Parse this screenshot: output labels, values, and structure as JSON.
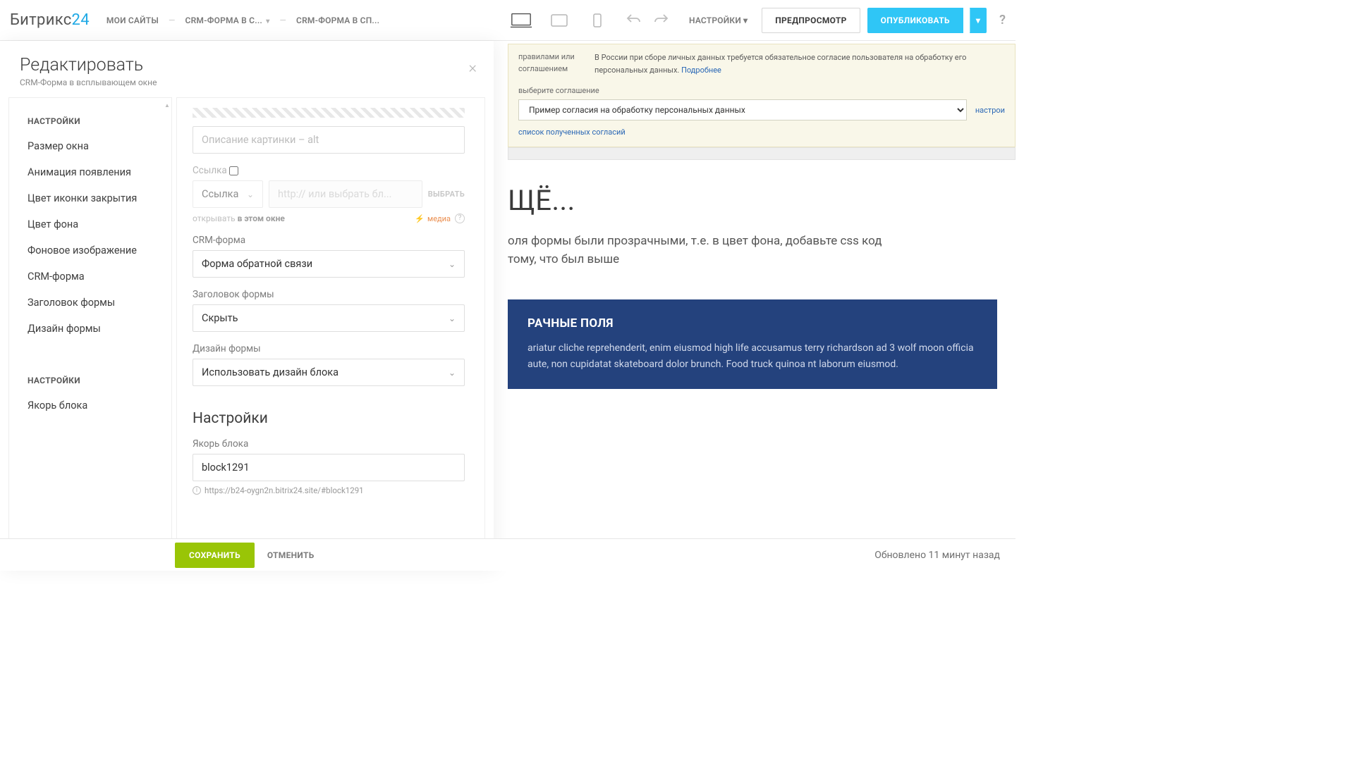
{
  "logo": {
    "part1": "Битрикс",
    "part2": "24"
  },
  "breadcrumbs": {
    "mysites": "МОИ САЙТЫ",
    "crm1": "CRM-ФОРМА В С...",
    "crm2": "CRM-ФОРМА В СП..."
  },
  "topbar": {
    "settings": "НАСТРОЙКИ",
    "preview": "ПРЕДПРОСМОТР",
    "publish": "ОПУБЛИКОВАТЬ",
    "help": "?"
  },
  "panel": {
    "title": "Редактировать",
    "subtitle": "CRM-Форма в всплывающем окне",
    "close": "×"
  },
  "sidemenu": {
    "sec1": "НАСТРОЙКИ",
    "items1": [
      "Размер окна",
      "Анимация появления",
      "Цвет иконки закрытия",
      "Цвет фона",
      "Фоновое изображение",
      "CRM-форма",
      "Заголовок формы",
      "Дизайн формы"
    ],
    "sec2": "НАСТРОЙКИ",
    "items2": [
      "Якорь блока"
    ]
  },
  "form": {
    "alt_placeholder": "Описание картинки – alt",
    "link_label": "Ссылка",
    "link_select": "Ссылка",
    "link_placeholder": "http:// или выбрать бл...",
    "choose": "ВЫБРАТЬ",
    "openin_prefix": "открывать",
    "openin_target": "в этом окне",
    "media": "медиа",
    "crm_label": "CRM-форма",
    "crm_value": "Форма обратной связи",
    "title_label": "Заголовок формы",
    "title_value": "Скрыть",
    "design_label": "Дизайн формы",
    "design_value": "Использовать дизайн блока",
    "settings_heading": "Настройки",
    "anchor_label": "Якорь блока",
    "anchor_value": "block1291",
    "anchor_url": "https://b24-oygn2n.bitrix24.site/#block1291"
  },
  "preview": {
    "agree_label": "правилами или соглашением",
    "agree_note_prefix": "В России при сборе личных данных требуется обязательное согласие пользователя на обработку его персональных данных.",
    "agree_more": "Подробнее",
    "agree_select_label": "выберите соглашение",
    "agree_select_value": "Пример согласия на обработку персональных данных",
    "agree_config": "настрои",
    "agree_list": "список полученных согласий",
    "h1": "ЩЁ...",
    "p1": "оля формы были прозрачными, т.е. в цвет фона, добавьте css код",
    "p2": "тому, что был выше",
    "acc_title": "РАЧНЫЕ ПОЛЯ",
    "acc_text": "ariatur cliche reprehenderit, enim eiusmod high life accusamus terry richardson ad 3 wolf moon officia aute, non cupidatat skateboard dolor brunch. Food truck quinoa nt laborum eiusmod."
  },
  "bottom": {
    "save": "СОХРАНИТЬ",
    "cancel": "ОТМЕНИТЬ",
    "updated": "Обновлено 11 минут назад"
  }
}
